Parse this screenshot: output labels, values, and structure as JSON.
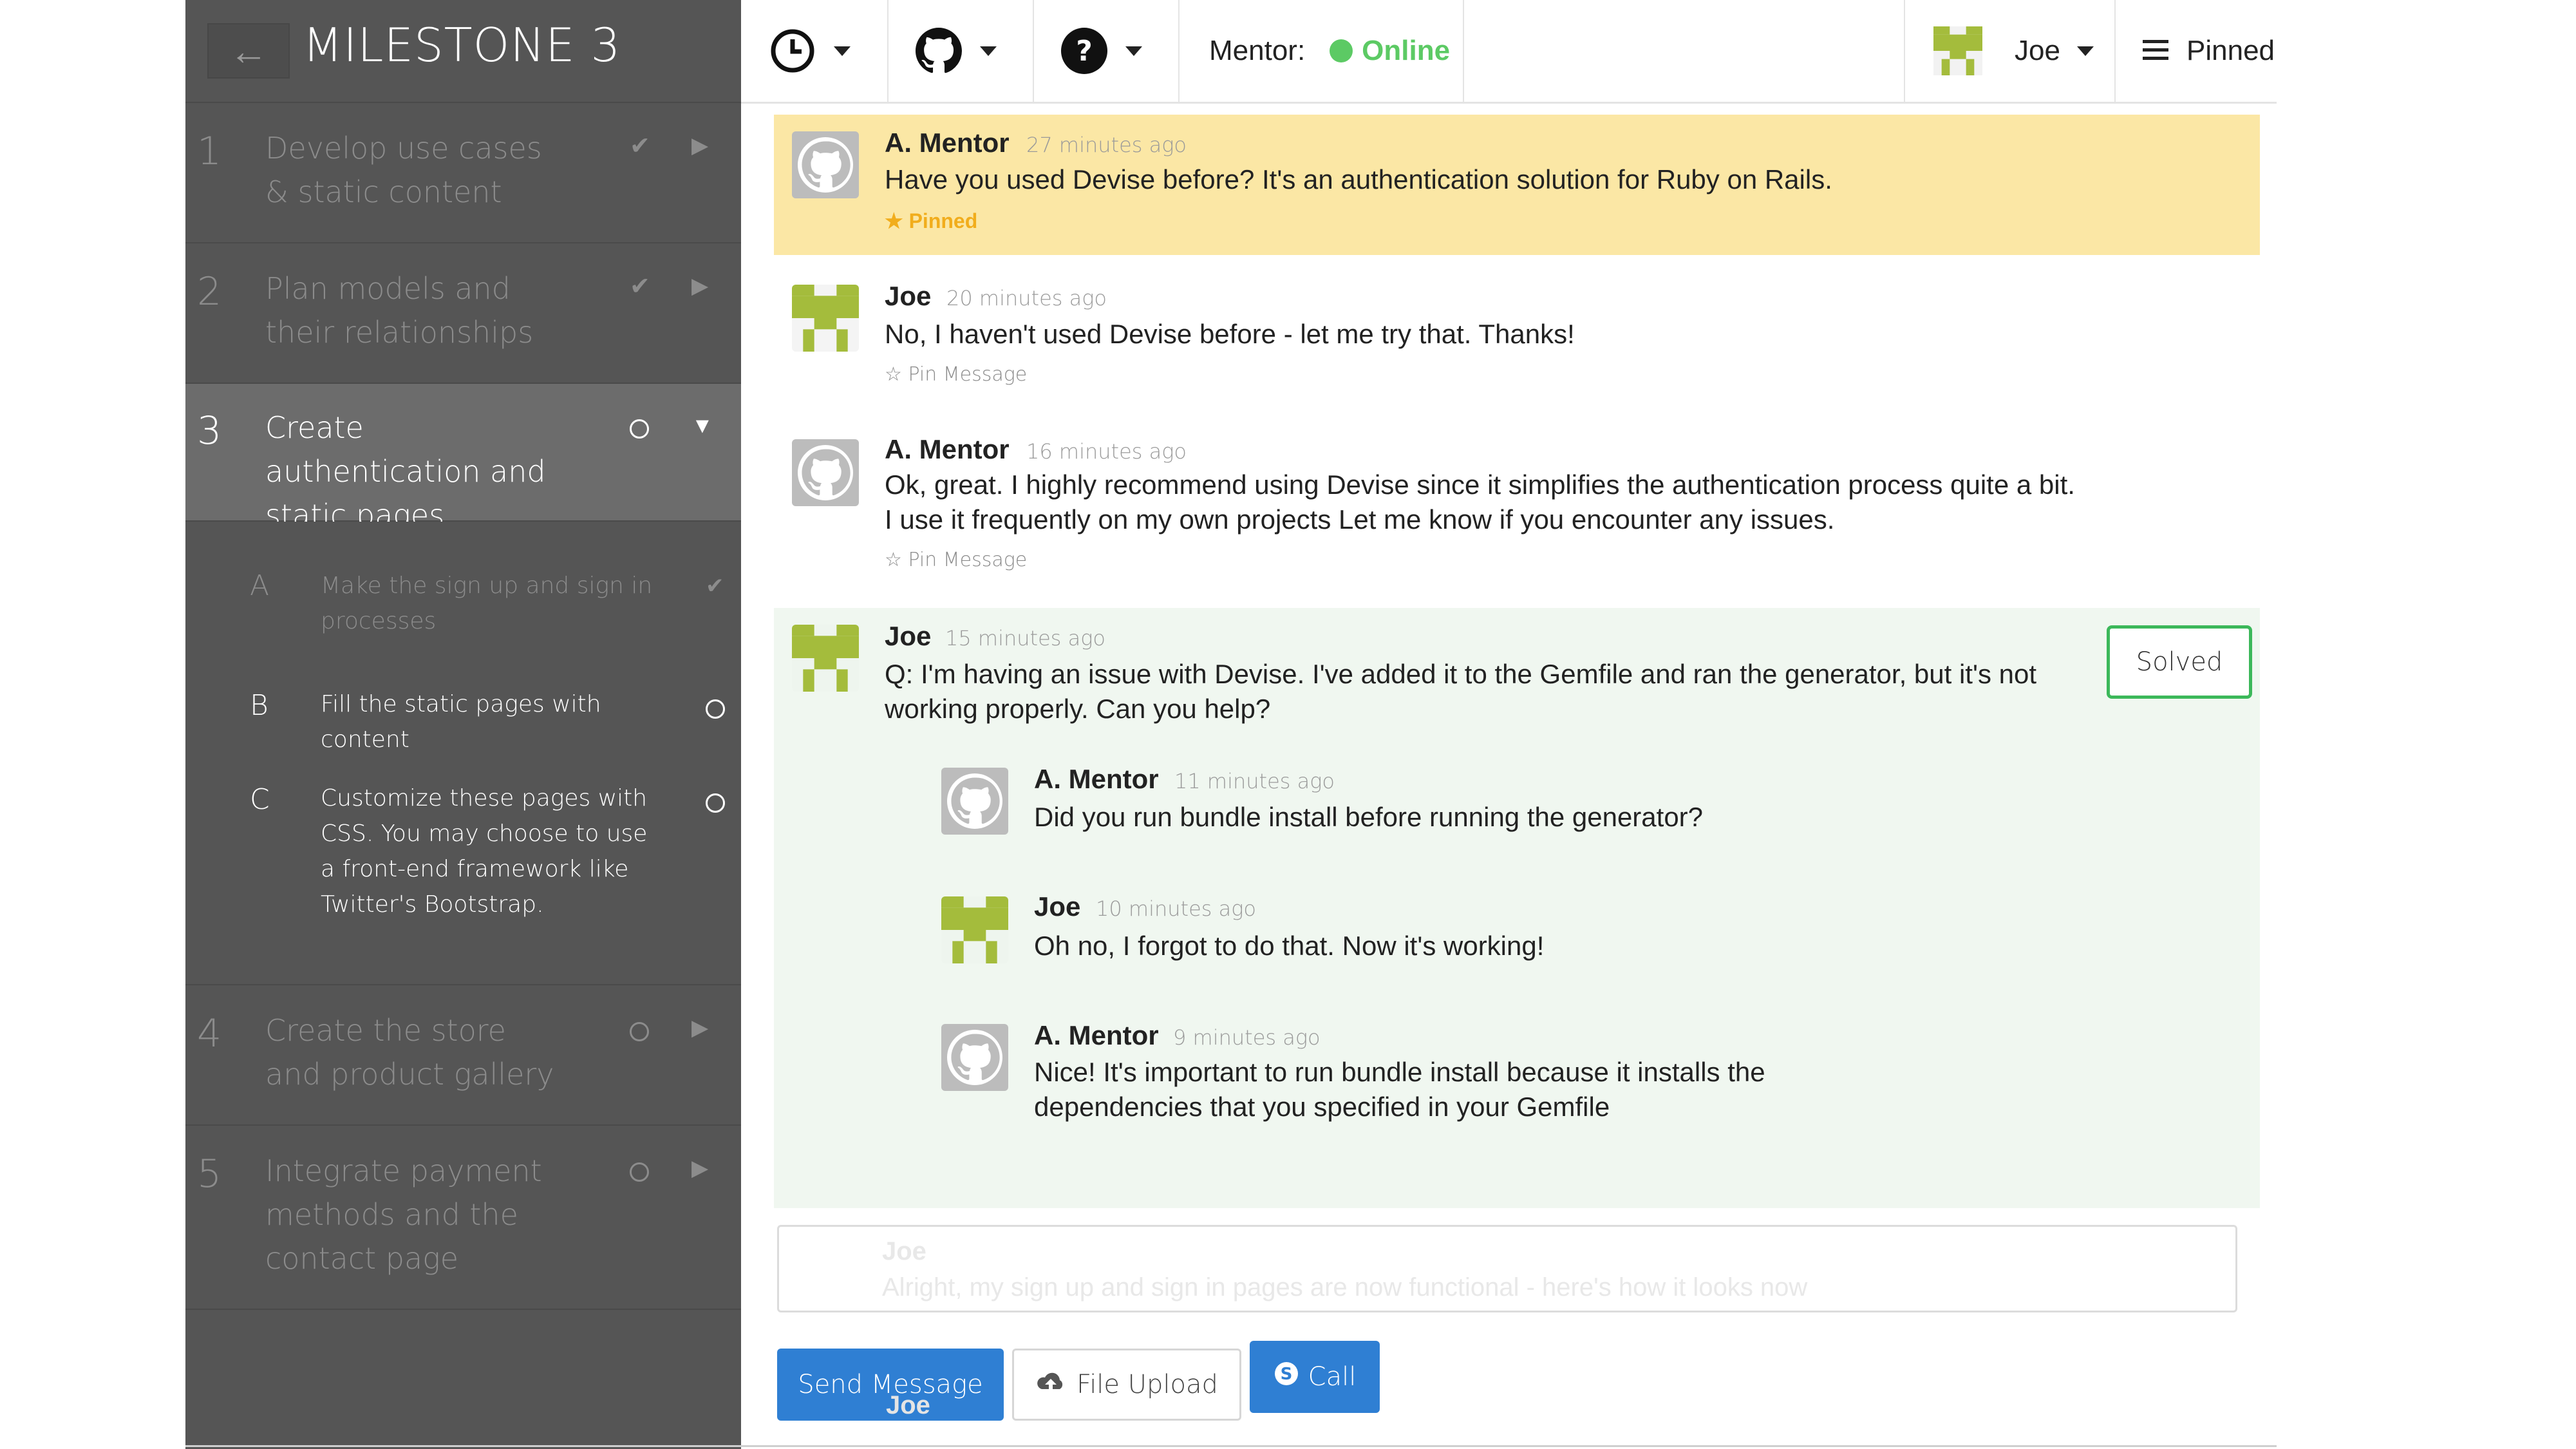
{
  "sidebar": {
    "back_label": "←",
    "title": "MILESTONE 3",
    "steps": [
      {
        "num": "1",
        "label": "Develop use cases & static content"
      },
      {
        "num": "2",
        "label": "Plan models and their relationships"
      },
      {
        "num": "3",
        "label": "Create authentication and static pages"
      },
      {
        "num": "4",
        "label": "Create the store and product gallery"
      },
      {
        "num": "5",
        "label": "Integrate payment methods and the contact page"
      }
    ],
    "substeps": [
      {
        "letter": "A",
        "text": "Make the sign up and sign in processes"
      },
      {
        "letter": "B",
        "text": "Fill the static pages with content"
      },
      {
        "letter": "C",
        "text": "Customize these pages with CSS. You may choose to use a front-end framework like Twitter's Bootstrap."
      }
    ]
  },
  "topbar": {
    "mentor_label": "Mentor:",
    "mentor_status": "Online",
    "user_name": "Joe",
    "pinned_label": "Pinned"
  },
  "messages": [
    {
      "author": "A. Mentor",
      "time": "27 minutes ago",
      "body": "Have you used Devise before? It's an authentication solution for Ruby on Rails.",
      "badge": "Pinned"
    },
    {
      "author": "Joe",
      "time": "20 minutes ago",
      "body": "No, I haven't used Devise before - let me try that. Thanks!",
      "action": "Pin Message"
    },
    {
      "author": "A. Mentor",
      "time": "16 minutes ago",
      "body_line1": "Ok, great. I highly recommend using Devise since it simplifies the authentication process quite a bit.",
      "body_line2": "I use it frequently on my own projects Let me know if you encounter any issues.",
      "action": "Pin Message"
    },
    {
      "author": "Joe",
      "time": "15 minutes ago",
      "body_line1": "Q: I'm having an issue with Devise. I've added it to the Gemfile and ran the generator, but it's not",
      "body_line2": "working properly. Can you help?",
      "solved": "Solved"
    }
  ],
  "replies": [
    {
      "author": "A. Mentor",
      "time": "11 minutes ago",
      "body": "Did you run bundle install before running the generator?"
    },
    {
      "author": "Joe",
      "time": "10 minutes ago",
      "body": "Oh no, I forgot to do that. Now it's working!"
    },
    {
      "author": "A. Mentor",
      "time": "9 minutes ago",
      "body_line1": "Nice! It's important to run bundle install because it installs the",
      "body_line2": "dependencies that you specified in your Gemfile"
    }
  ],
  "composer": {
    "ghost_author": "Joe",
    "ghost_text": "Alright, my sign up and sign in pages are now functional - here's how it looks now",
    "send_label": "Send Message",
    "upload_label": "File Upload",
    "call_label": "Call"
  },
  "colors": {
    "sidebar_bg": "#555555",
    "active_step_bg": "#6c6c6c",
    "pinned_bg": "#fbe7a5",
    "thread_bg": "#f0f7f0",
    "online": "#5cca64",
    "primary_button": "#2f7fd3",
    "solved_border": "#3cb85a"
  }
}
